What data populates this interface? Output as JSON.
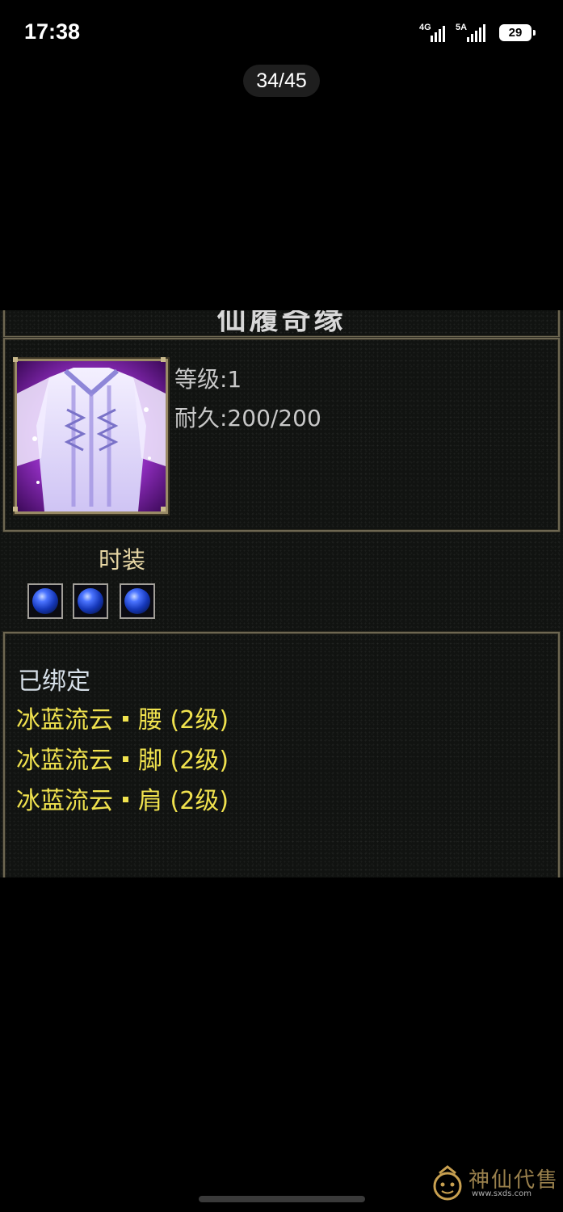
{
  "status_bar": {
    "time": "17:38",
    "signal1_label": "4G",
    "signal2_label": "5A",
    "battery": "29"
  },
  "viewer": {
    "page_counter": "34/45"
  },
  "item": {
    "name": "仙履奇缘",
    "level_label": "等级:1",
    "durability_label": "耐久:200/200",
    "category": "时装",
    "gem_slots": 3,
    "bound_text": "已绑定",
    "set_bonuses": [
      {
        "name": "冰蓝流云",
        "part": "腰 (2级)"
      },
      {
        "name": "冰蓝流云",
        "part": "脚 (2级)"
      },
      {
        "name": "冰蓝流云",
        "part": "肩 (2级)"
      }
    ]
  },
  "colors": {
    "bound": "#d6dfe8",
    "set_bonus": "#f0e24e",
    "category": "#e6d6a4",
    "frame": "#6e6752"
  },
  "watermark": {
    "brand": "神仙代售",
    "url": "www.sxds.com"
  }
}
